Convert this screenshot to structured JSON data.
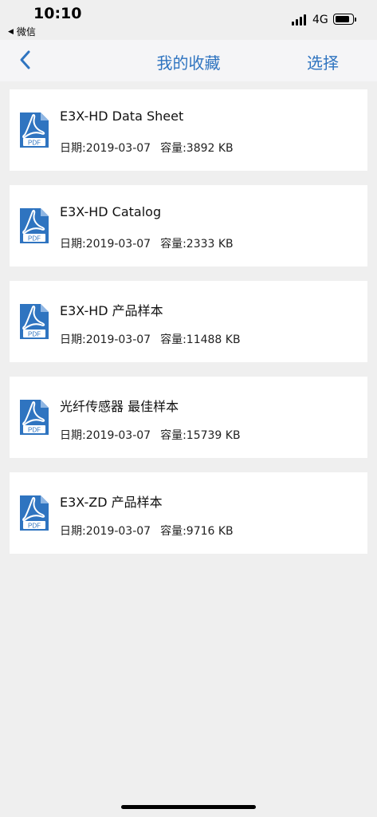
{
  "status_bar": {
    "time": "10:10",
    "back_app": "微信",
    "network": "4G"
  },
  "nav": {
    "title": "我的收藏",
    "action": "选择"
  },
  "items": [
    {
      "title": "E3X-HD Data Sheet",
      "date": "日期:2019-03-07",
      "size": "容量:3892 KB",
      "icon_label": "PDF"
    },
    {
      "title": "E3X-HD Catalog",
      "date": "日期:2019-03-07",
      "size": "容量:2333 KB",
      "icon_label": "PDF"
    },
    {
      "title": "E3X-HD 产品样本",
      "date": "日期:2019-03-07",
      "size": "容量:11488 KB",
      "icon_label": "PDF"
    },
    {
      "title": "光纤传感器 最佳样本",
      "date": "日期:2019-03-07",
      "size": "容量:15739 KB",
      "icon_label": "PDF"
    },
    {
      "title": "E3X-ZD 产品样本",
      "date": "日期:2019-03-07",
      "size": "容量:9716 KB",
      "icon_label": "PDF"
    }
  ],
  "colors": {
    "accent": "#2f74c0",
    "pdf_icon": "#2f74c0",
    "background": "#efefef"
  }
}
